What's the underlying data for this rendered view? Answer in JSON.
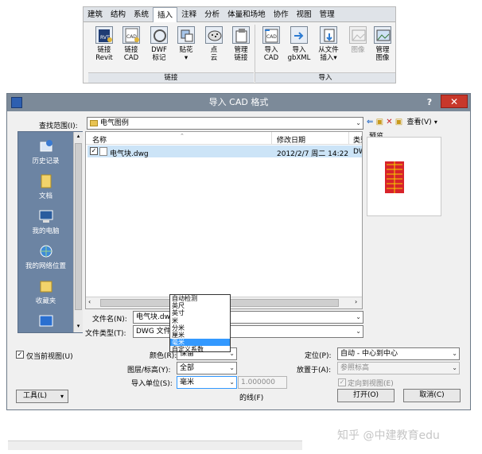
{
  "ribbon": {
    "tabs": [
      "建筑",
      "结构",
      "系统",
      "插入",
      "注释",
      "分析",
      "体量和场地",
      "协作",
      "视图",
      "管理"
    ],
    "active_tab": "插入",
    "buttons": [
      {
        "label": "链接\nRevit",
        "icon": "link-revit-icon"
      },
      {
        "label": "链接\nCAD",
        "icon": "link-cad-icon"
      },
      {
        "label": "DWF\n标记",
        "icon": "dwf-markup-icon"
      },
      {
        "label": "贴花\n▾",
        "icon": "decal-icon"
      },
      {
        "label": "点\n云",
        "icon": "point-cloud-icon"
      },
      {
        "label": "管理\n链接",
        "icon": "manage-links-icon"
      },
      {
        "label": "导入\nCAD",
        "icon": "import-cad-icon"
      },
      {
        "label": "导入\ngbXML",
        "icon": "import-gbxml-icon"
      },
      {
        "label": "从文件\n插入▾",
        "icon": "insert-from-file-icon"
      },
      {
        "label": "图像",
        "icon": "image-icon"
      },
      {
        "label": "管理\n图像",
        "icon": "manage-images-icon"
      }
    ],
    "groups": {
      "link": "链接",
      "import": "导入"
    }
  },
  "dialog": {
    "title": "导入 CAD 格式",
    "help": "?",
    "close": "✕",
    "look_in_label": "查找范围(I):",
    "look_in_value": "电气图例",
    "toolbar": {
      "views_label": "查看(V)"
    },
    "preview_label": "预览",
    "places": [
      "历史记录",
      "文档",
      "我的电脑",
      "我的网络位置",
      "收藏夹"
    ],
    "columns": {
      "name": "名称",
      "date": "修改日期",
      "type": "类型"
    },
    "files": [
      {
        "name": "电气块.dwg",
        "date": "2012/2/7 周二 14:22",
        "type": "DW("
      }
    ],
    "filename_label": "文件名(N):",
    "filename_value": "电气块.dwg",
    "filetype_label": "文件类型(T):",
    "filetype_value": "DWG 文件 (*.dwg)",
    "current_view_only": "仅当前视图(U)",
    "colors_label": "颜色(R):",
    "colors_value": "保留",
    "layers_label": "图层/标高(Y):",
    "layers_value": "全部",
    "units_label": "导入单位(S):",
    "units_value": "毫米",
    "scale_value": "1.000000",
    "positioning_label": "定位(P):",
    "positioning_value": "自动 - 中心到中心",
    "place_at_label": "放置于(A):",
    "place_at_value": "参照标高",
    "orient_label": "定向到视图(E)",
    "partial_label": "的线(F)",
    "tools_button": "工具(L)",
    "open_button": "打开(O)",
    "cancel_button": "取消(C)",
    "units_options": [
      "自动检测",
      "英尺",
      "英寸",
      "米",
      "分米",
      "厘米",
      "毫米",
      "自定义系数"
    ],
    "units_selected_index": 6
  },
  "watermark": "知乎 @中建教育edu"
}
